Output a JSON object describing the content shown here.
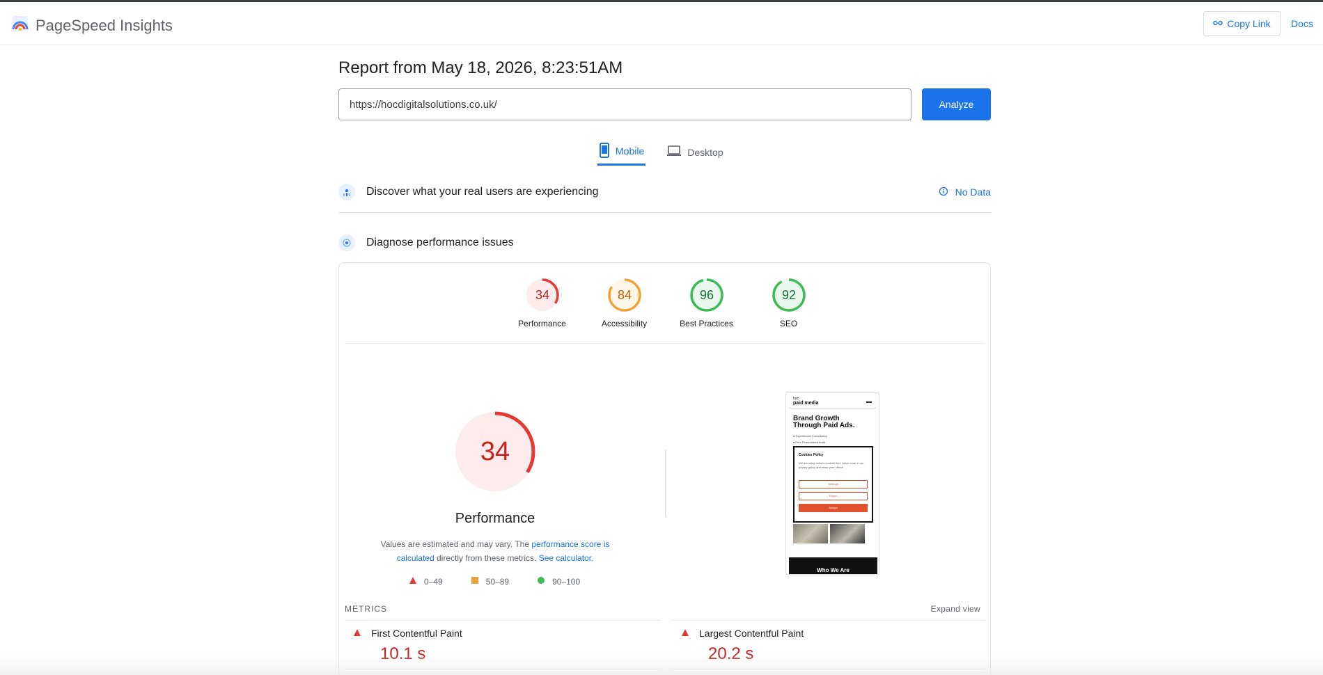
{
  "header": {
    "app_name": "PageSpeed Insights",
    "copy_link_label": "Copy Link",
    "docs_label": "Docs"
  },
  "report": {
    "title": "Report from May 18, 2026, 8:23:51AM",
    "url_value": "https://hocdigitalsolutions.co.uk/",
    "analyze_label": "Analyze"
  },
  "tabs": [
    {
      "label": "Mobile",
      "icon": "smartphone-icon",
      "selected": true
    },
    {
      "label": "Desktop",
      "icon": "laptop-icon",
      "selected": false
    }
  ],
  "real_users": {
    "title": "Discover what your real users are experiencing",
    "status": "No Data"
  },
  "diagnose": {
    "title": "Diagnose performance issues"
  },
  "scores": [
    {
      "label": "Performance",
      "value": 34,
      "color": "#e53935",
      "bg": "#fdeceb"
    },
    {
      "label": "Accessibility",
      "value": 84,
      "color": "#f0a23a",
      "bg": "#fff6e8"
    },
    {
      "label": "Best Practices",
      "value": 96,
      "color": "#3cba54",
      "bg": "#eaf7ec"
    },
    {
      "label": "SEO",
      "value": 92,
      "color": "#3cba54",
      "bg": "#eaf7ec"
    }
  ],
  "performance": {
    "score": 34,
    "label": "Performance",
    "desc_1": "Values are estimated and may vary. The ",
    "desc_link_1": "performance score is calculated",
    "desc_2": " directly from these metrics. ",
    "desc_link_2": "See calculator."
  },
  "legend": [
    {
      "range": "0–49",
      "shape": "triangle",
      "color": "#e53935"
    },
    {
      "range": "50–89",
      "shape": "square",
      "color": "#f0a23a"
    },
    {
      "range": "90–100",
      "shape": "circle",
      "color": "#3cba54"
    }
  ],
  "screenshot": {
    "logo_top": "hoc",
    "logo_bottom": "paid media",
    "headline_1": "Brand Growth",
    "headline_2": "Through Paid Ads.",
    "bullet_1": "Experienced Consultancy",
    "bullet_2": "Free Personalised Audit",
    "cookie_title": "Cookies Policy",
    "cookie_text": "We are using various cookies first. Learn more in our privacy policy and make your choice.",
    "btn_settings": "Settings",
    "btn_reject": "Reject",
    "btn_accept": "Accept",
    "footer_text": "Who We Are"
  },
  "metrics": {
    "section_label": "METRICS",
    "expand_label": "Expand view",
    "items": [
      {
        "name": "First Contentful Paint",
        "value": "10.1 s"
      },
      {
        "name": "Largest Contentful Paint",
        "value": "20.2 s"
      }
    ]
  }
}
